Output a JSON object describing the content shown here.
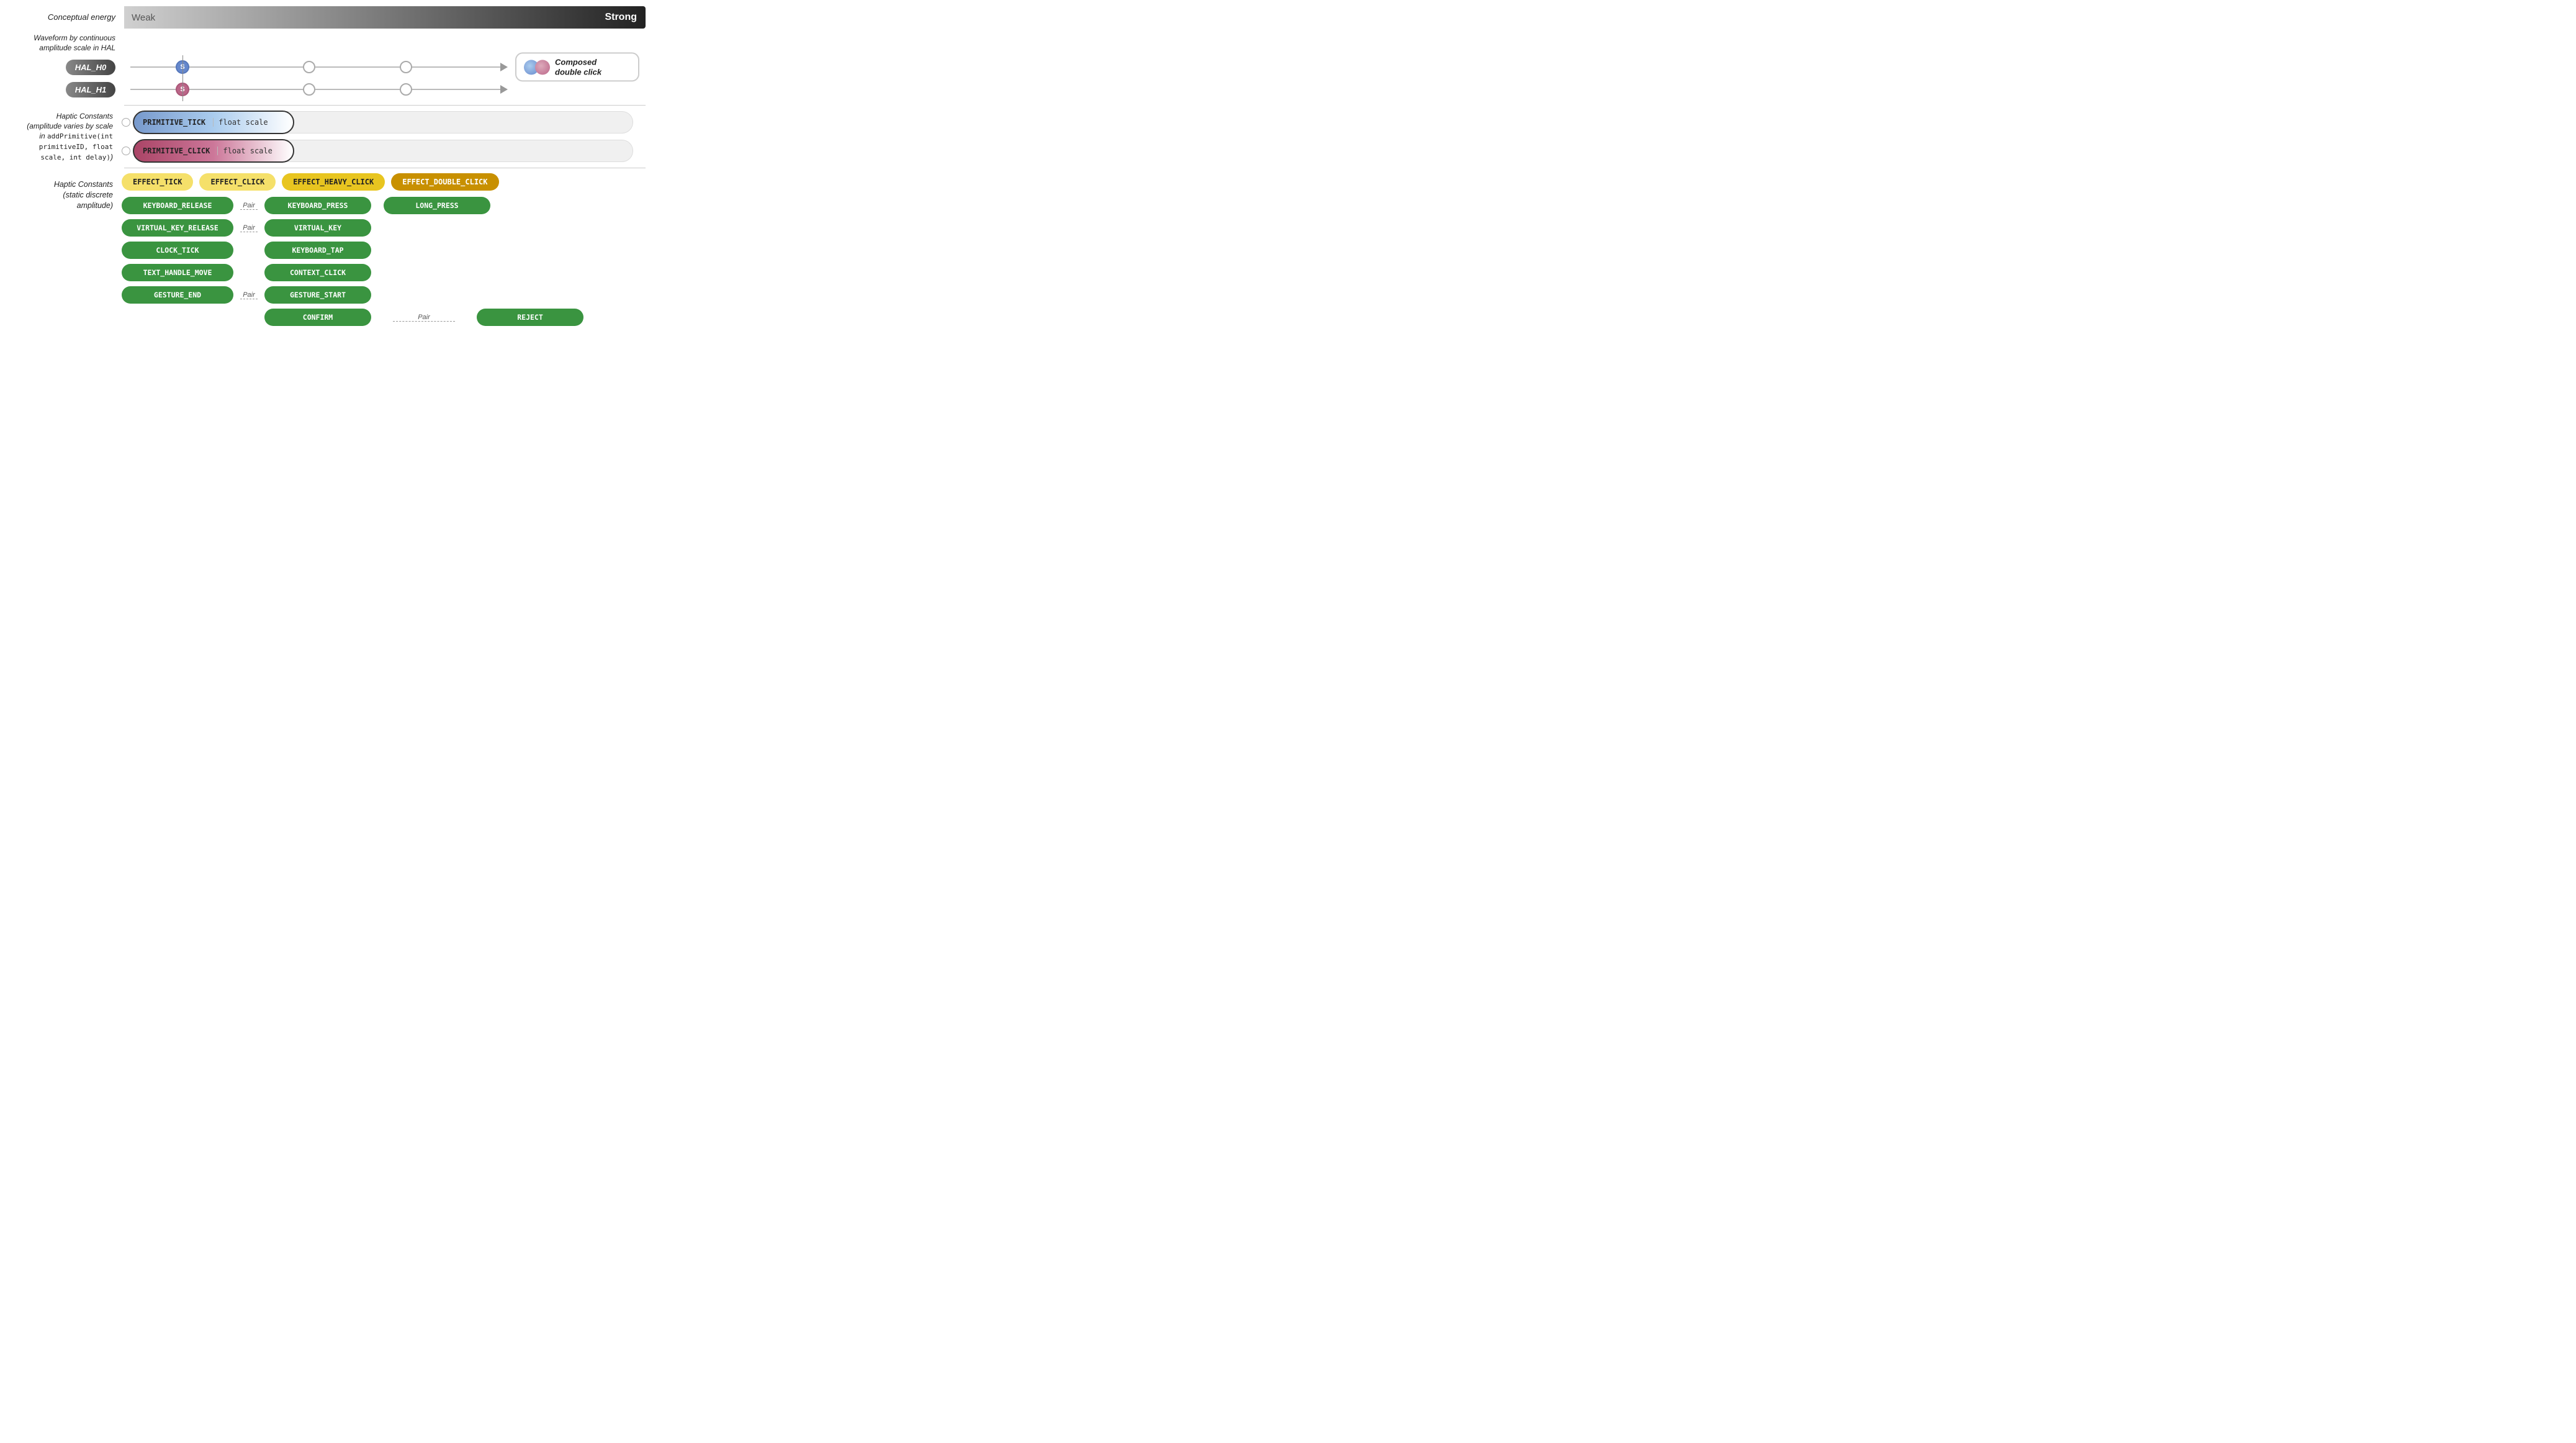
{
  "energy": {
    "label": "Conceptual energy",
    "weak": "Weak",
    "strong": "Strong"
  },
  "waveform": {
    "label": "Waveform by continuous amplitude scale in HAL"
  },
  "hal": {
    "h0": {
      "label": "HAL_H0",
      "s": "S"
    },
    "h1": {
      "label": "HAL_H1",
      "s": "S"
    }
  },
  "composed_legend": {
    "text_line1": "Composed",
    "text_line2": "double click"
  },
  "primitives": {
    "section_label_line1": "Haptic Constants",
    "section_label_line2": "(amplitude varies by scale",
    "section_label_line3": "in",
    "section_label_code": "addPrimitive(int primitiveID, float scale, int delay)",
    "section_label_line4": ")",
    "tick": {
      "name": "PRIMITIVE_TICK",
      "scale": "float scale"
    },
    "click": {
      "name": "PRIMITIVE_CLICK",
      "scale": "float scale"
    }
  },
  "discrete": {
    "section_label": "Haptic Constants\n(static discrete\namplitude)",
    "effects": [
      {
        "label": "EFFECT_TICK",
        "style": "light"
      },
      {
        "label": "EFFECT_CLICK",
        "style": "light"
      },
      {
        "label": "EFFECT_HEAVY_CLICK",
        "style": "mid"
      },
      {
        "label": "EFFECT_DOUBLE_CLICK",
        "style": "dark"
      }
    ],
    "green_items": [
      {
        "label": "KEYBOARD_RELEASE",
        "col": 0,
        "row": 0
      },
      {
        "label": "KEYBOARD_PRESS",
        "col": 1,
        "row": 0
      },
      {
        "label": "LONG_PRESS",
        "col": 2,
        "row": 0
      },
      {
        "label": "VIRTUAL_KEY_RELEASE",
        "col": 0,
        "row": 1
      },
      {
        "label": "VIRTUAL_KEY",
        "col": 1,
        "row": 1
      },
      {
        "label": "CLOCK_TICK",
        "col": 0,
        "row": 2
      },
      {
        "label": "KEYBOARD_TAP",
        "col": 1,
        "row": 2
      },
      {
        "label": "TEXT_HANDLE_MOVE",
        "col": 0,
        "row": 3
      },
      {
        "label": "CONTEXT_CLICK",
        "col": 1,
        "row": 3
      },
      {
        "label": "GESTURE_END",
        "col": 0,
        "row": 4
      },
      {
        "label": "GESTURE_START",
        "col": 1,
        "row": 4
      },
      {
        "label": "CONFIRM",
        "col": 1,
        "row": 5
      },
      {
        "label": "REJECT",
        "col": 3,
        "row": 5
      }
    ],
    "pair_labels": [
      {
        "text": "Pair",
        "between_col": "0-1",
        "row": 0
      },
      {
        "text": "Pair",
        "between_col": "0-1",
        "row": 1
      },
      {
        "text": "Pair",
        "between_col": "0-1",
        "row": 4
      },
      {
        "text": "Pair",
        "between_col": "2-3",
        "row": 5
      }
    ]
  }
}
